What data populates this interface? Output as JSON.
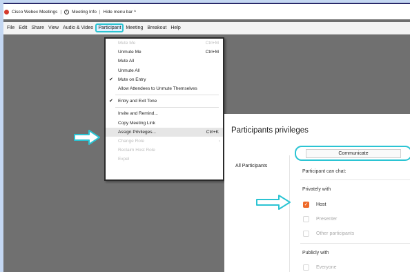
{
  "titlebar": {
    "app_name": "Cisco Webex Meetings",
    "separator": "|",
    "meeting_info": "Meeting Info",
    "hide_menu_bar": "Hide menu bar ^"
  },
  "menubar": {
    "items": [
      "File",
      "Edit",
      "Share",
      "View",
      "Audio & Video",
      "Participant",
      "Meeting",
      "Breakout",
      "Help"
    ],
    "active": "Participant"
  },
  "participant_menu": {
    "items": [
      {
        "label": "Mute Me",
        "shortcut": "Ctrl+M",
        "disabled": true
      },
      {
        "label": "Unmute Me",
        "shortcut": "Ctrl+M",
        "disabled": false
      },
      {
        "label": "Mute All",
        "disabled": false
      },
      {
        "label": "Unmute All",
        "disabled": false
      },
      {
        "label": "Mute on Entry",
        "checked": true,
        "disabled": false
      },
      {
        "label": "Allow Attendees to Unmute Themselves",
        "disabled": false
      },
      {
        "label": "Entry and Exit Tone",
        "checked": true,
        "disabled": false
      },
      {
        "label": "Invite and Remind...",
        "disabled": false
      },
      {
        "label": "Copy Meeting Link",
        "disabled": false
      },
      {
        "label": "Assign Privileges...",
        "shortcut": "Ctrl+K",
        "disabled": false,
        "highlighted": true
      },
      {
        "label": "Change Role",
        "disabled": true,
        "submenu": true
      },
      {
        "label": "Reclaim Host Role",
        "disabled": true
      },
      {
        "label": "Expel",
        "disabled": true
      }
    ],
    "check_glyph": "✔",
    "submenu_glyph": "›"
  },
  "privileges_panel": {
    "title": "Participants privileges",
    "left_nav": "All Participants",
    "tab": "Communicate",
    "can_chat_label": "Participant can chat:",
    "privately_label": "Privately with",
    "private_options": [
      {
        "label": "Host",
        "checked": true
      },
      {
        "label": "Presenter",
        "checked": false
      },
      {
        "label": "Other participants",
        "checked": false
      }
    ],
    "publicly_label": "Publicly with",
    "public_options": [
      {
        "label": "Everyone",
        "checked": false
      }
    ],
    "check_glyph": "✓"
  },
  "colors": {
    "highlight_outline": "#2bc4d3",
    "checkbox_on": "#ee6a2a",
    "webex_dot": "#d43a2e"
  },
  "icons": [
    "webex-logo-icon",
    "info-icon",
    "arrow-right-icon",
    "check-icon",
    "chevron-right-icon"
  ]
}
